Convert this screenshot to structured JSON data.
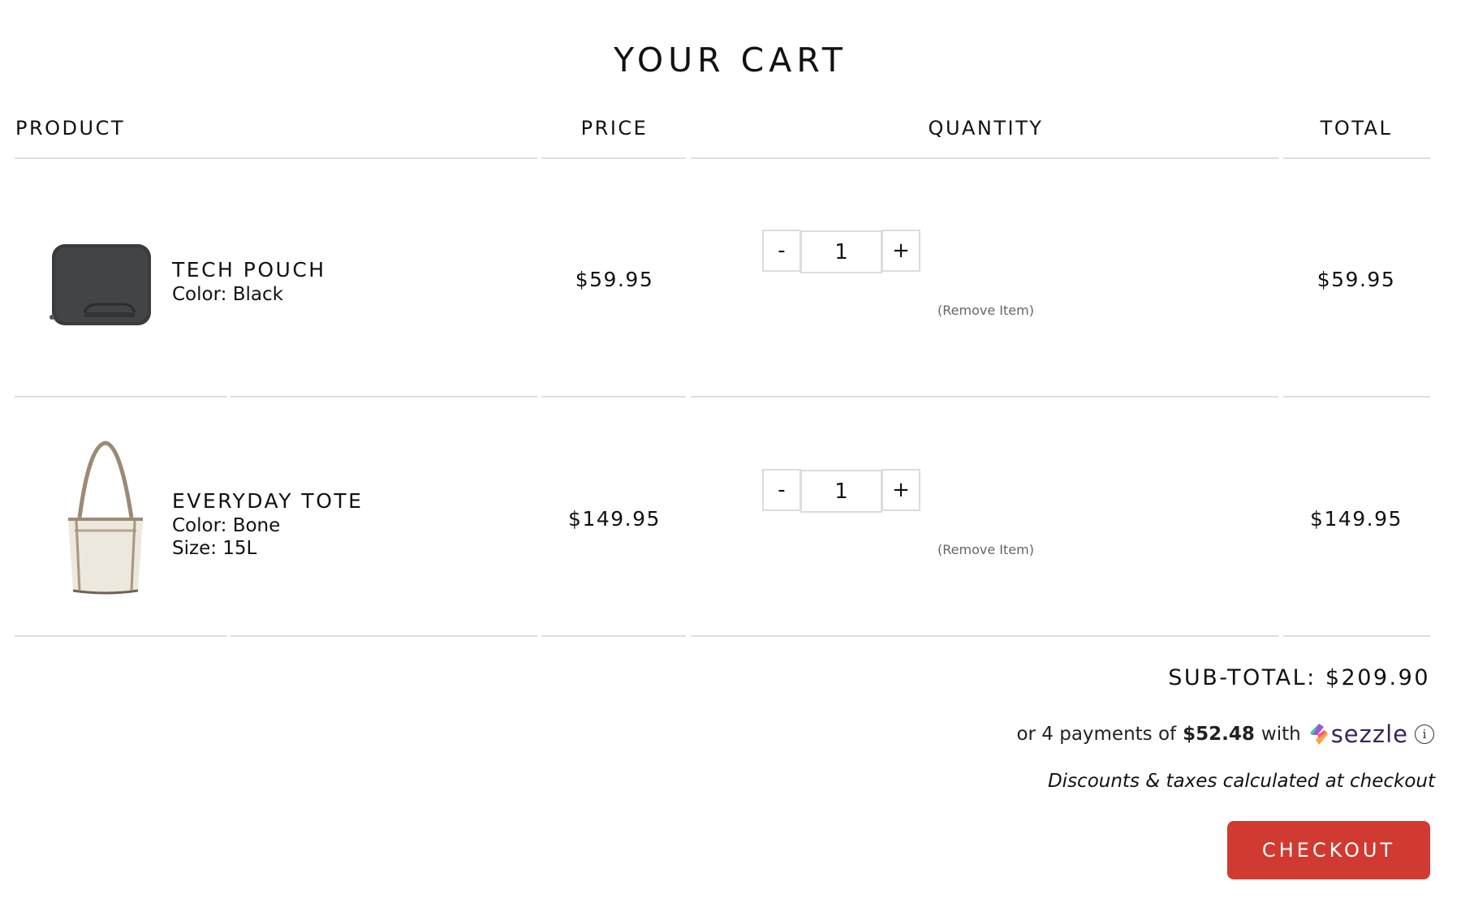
{
  "page": {
    "title": "YOUR CART"
  },
  "table": {
    "headers": {
      "product": "PRODUCT",
      "price": "PRICE",
      "quantity": "QUANTITY",
      "total": "TOTAL"
    },
    "items": [
      {
        "name": "TECH POUCH",
        "options": [
          "Color: Black"
        ],
        "image": "tech-pouch-black",
        "price": "$59.95",
        "quantity": "1",
        "total": "$59.95",
        "minus_label": "-",
        "plus_label": "+",
        "remove_label": "(Remove Item)"
      },
      {
        "name": "EVERYDAY TOTE",
        "options": [
          "Color: Bone",
          "Size: 15L"
        ],
        "image": "everyday-tote-bone",
        "price": "$149.95",
        "quantity": "1",
        "total": "$149.95",
        "minus_label": "-",
        "plus_label": "+",
        "remove_label": "(Remove Item)"
      }
    ]
  },
  "summary": {
    "subtotal_label": "SUB-TOTAL:",
    "subtotal_value": "$209.90",
    "installments_prefix": "or 4 payments of",
    "installment_amount": "$52.48",
    "installments_suffix": "with",
    "provider_name": "sezzle",
    "provider_icon": "sezzle-logo-icon",
    "info_icon": "info-icon",
    "info_glyph": "i",
    "disclaimer": "Discounts & taxes calculated at checkout",
    "checkout_label": "CHECKOUT"
  },
  "colors": {
    "checkout_button": "#d03a31",
    "sezzle_text": "#392558",
    "divider": "#dedede"
  }
}
